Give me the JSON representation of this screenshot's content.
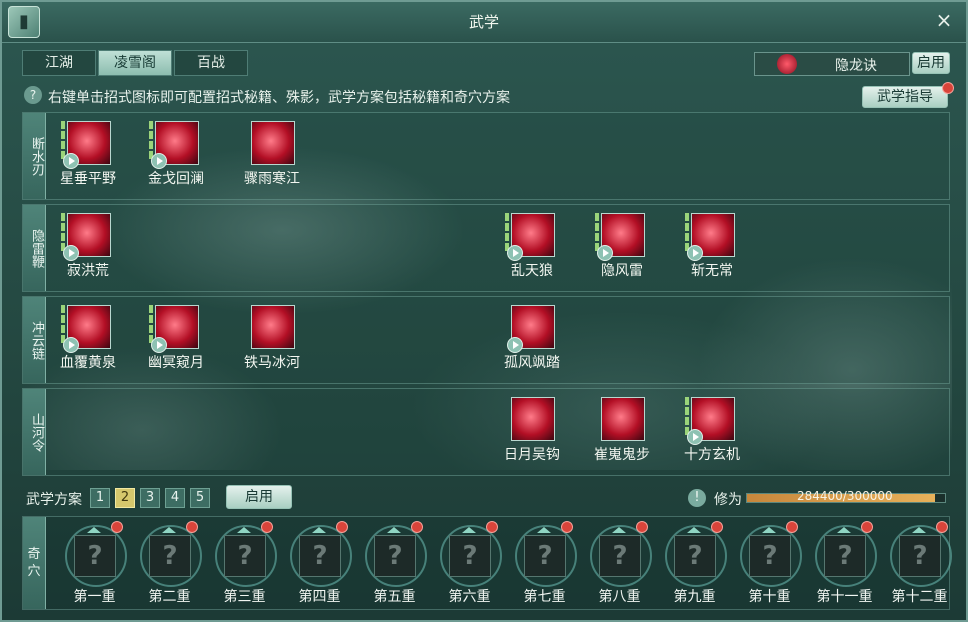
{
  "window": {
    "title": "武学",
    "close_icon": "×",
    "book_icon": "book-icon"
  },
  "tabs": [
    {
      "label": "江湖"
    },
    {
      "label": "凌雪阁",
      "active": true
    },
    {
      "label": "百战"
    }
  ],
  "yinlong": {
    "label": "隐龙诀",
    "enable": "启用"
  },
  "hint": {
    "icon": "?",
    "text": "右键单击招式图标即可配置招式秘籍、殊影，武学方案包括秘籍和奇穴方案"
  },
  "guide_button": "武学指导",
  "rows": [
    {
      "label": "断水刃",
      "skills": [
        {
          "name": "星垂平野",
          "play": true,
          "bars": true
        },
        {
          "name": "金戈回澜",
          "play": true,
          "bars": true
        },
        {
          "name": "骤雨寒江",
          "play": false,
          "bars": false
        }
      ]
    },
    {
      "label": "隐雷鞭",
      "skills": [
        {
          "name": "寂洪荒",
          "play": true,
          "bars": true
        },
        {
          "name": "乱天狼",
          "play": true,
          "bars": true
        },
        {
          "name": "隐风雷",
          "play": true,
          "bars": true
        },
        {
          "name": "斩无常",
          "play": true,
          "bars": true
        }
      ]
    },
    {
      "label": "冲云链",
      "skills": [
        {
          "name": "血覆黄泉",
          "play": true,
          "bars": true
        },
        {
          "name": "幽冥窥月",
          "play": true,
          "bars": true
        },
        {
          "name": "铁马冰河",
          "play": false,
          "bars": false
        },
        {
          "name": "孤风飒踏",
          "play": true,
          "bars": false
        }
      ]
    },
    {
      "label": "山河令",
      "skills": [
        {
          "name": "日月吴钩",
          "play": false,
          "bars": false
        },
        {
          "name": "崔嵬鬼步",
          "play": false,
          "bars": false
        },
        {
          "name": "十方玄机",
          "play": true,
          "bars": true
        }
      ]
    }
  ],
  "scheme": {
    "label": "武学方案",
    "numbers": [
      "1",
      "2",
      "3",
      "4",
      "5"
    ],
    "active": 2,
    "apply": "启用"
  },
  "cultivation": {
    "icon": "!",
    "label": "修为",
    "value": "284400/300000",
    "progress": 0.948
  },
  "qixue": {
    "label": "奇穴",
    "slots": [
      "第一重",
      "第二重",
      "第三重",
      "第四重",
      "第五重",
      "第六重",
      "第七重",
      "第八重",
      "第九重",
      "第十重",
      "第十一重",
      "第十二重"
    ],
    "slot_icon": "?"
  }
}
